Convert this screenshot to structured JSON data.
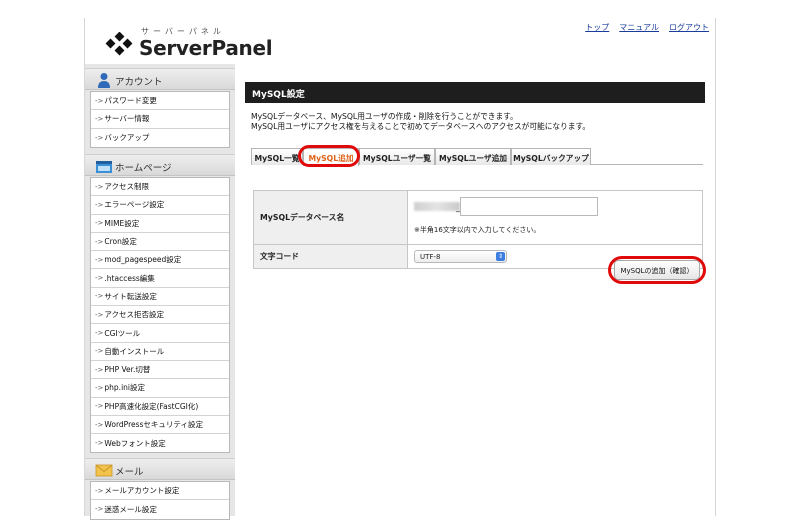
{
  "header": {
    "logo_kana": "サーバーパネル",
    "logo_word": "ServerPanel",
    "links": [
      "トップ",
      "マニュアル",
      "ログアウト"
    ]
  },
  "sidebar": {
    "sections": [
      {
        "title": "アカウント",
        "icon": "person-icon",
        "items": [
          "パスワード変更",
          "サーバー情報",
          "バックアップ"
        ]
      },
      {
        "title": "ホームページ",
        "icon": "homepage-icon",
        "items": [
          "アクセス制限",
          "エラーページ設定",
          "MIME設定",
          "Cron設定",
          "mod_pagespeed設定",
          ".htaccess編集",
          "サイト転送設定",
          "アクセス拒否設定",
          "CGIツール",
          "自動インストール",
          "PHP Ver.切替",
          "php.ini設定",
          "PHP高速化設定(FastCGI化)",
          "WordPressセキュリティ設定",
          "Webフォント設定"
        ]
      },
      {
        "title": "メール",
        "icon": "mail-icon",
        "items": [
          "メールアカウント設定",
          "迷惑メール設定"
        ]
      }
    ],
    "item_prefix": "->"
  },
  "main": {
    "title": "MySQL設定",
    "description": [
      "MySQLデータベース、MySQL用ユーザの作成・削除を行うことができます。",
      "MySQL用ユーザにアクセス権を与えることで初めてデータベースへのアクセスが可能になります。"
    ],
    "tabs": [
      {
        "label": "MySQL一覧",
        "active": false
      },
      {
        "label": "MySQL追加",
        "active": true
      },
      {
        "label": "MySQLユーザ一覧",
        "active": false
      },
      {
        "label": "MySQLユーザ追加",
        "active": false
      },
      {
        "label": "MySQLバックアップ",
        "active": false
      }
    ],
    "form": {
      "db_label": "MySQLデータベース名",
      "db_prefix_sep": "_",
      "db_value": "",
      "db_note": "※半角16文字以内で入力してください。",
      "charset_label": "文字コード",
      "charset_value": "UTF-8"
    },
    "confirm_button": "MySQLの追加（確認）"
  },
  "colors": {
    "title_bar": "#1e1e1e",
    "active_tab_text": "#e0631a",
    "highlight_ring": "#e00a0a",
    "link": "#1a3d9c"
  }
}
